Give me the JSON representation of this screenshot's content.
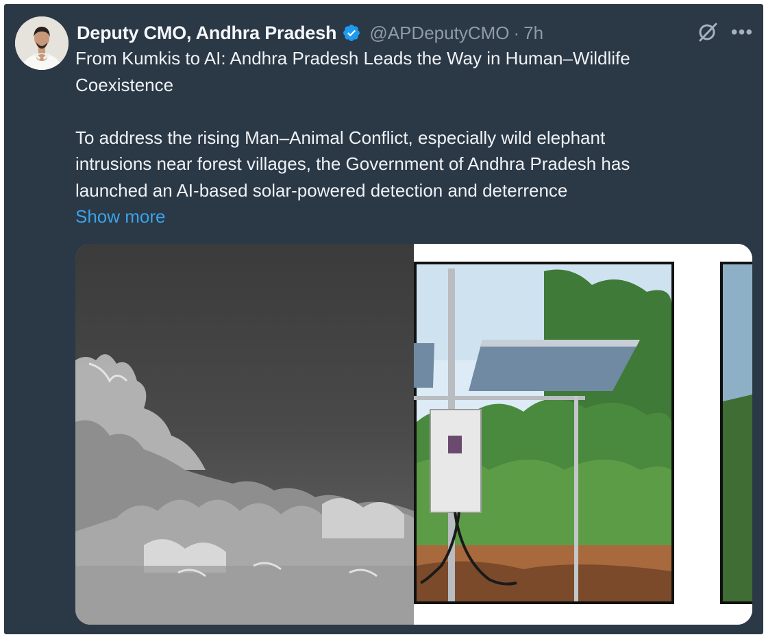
{
  "author": {
    "name": "Deputy CMO, Andhra Pradesh",
    "handle": "@APDeputyCMO",
    "separator": "·",
    "time": "7h",
    "verified": true
  },
  "post": {
    "title_lines": [
      "From Kumkis to AI: Andhra Pradesh Leads the Way in Human–Wildlife",
      "Coexistence"
    ],
    "body_lines": [
      "To address the rising Man–Animal Conflict, especially wild elephant",
      "intrusions near forest villages, the Government of Andhra Pradesh has",
      "launched an AI-based solar-powered detection and deterrence"
    ],
    "show_more": "Show more"
  },
  "media": {
    "images": [
      {
        "name": "thermal-camera-image",
        "kind": "grayscale thermal night view of forest vegetation"
      },
      {
        "name": "solar-panel-detector-image",
        "kind": "solar panel with control box in green bushes"
      }
    ]
  },
  "icons": {
    "verified": "verified-badge-icon",
    "grok": "grok-icon",
    "more": "more-options-icon"
  },
  "colors": {
    "background": "#2b3846",
    "text": "#eef2f6",
    "muted": "#8f9bab",
    "link": "#3aa3e8",
    "verified": "#1d9bf0"
  }
}
